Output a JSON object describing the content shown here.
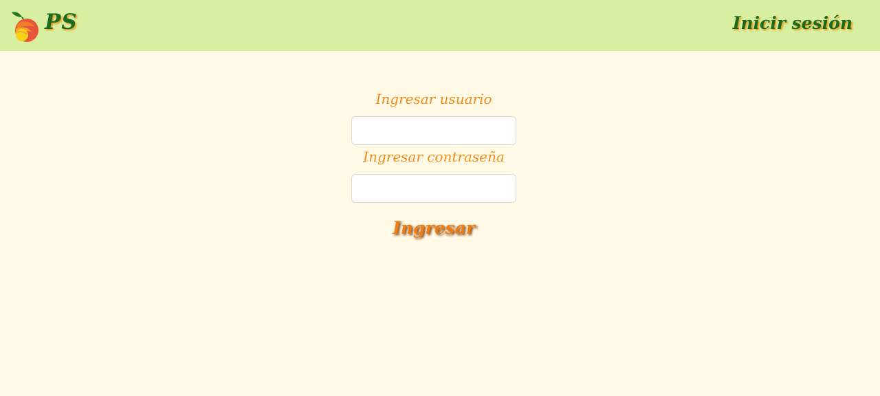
{
  "header": {
    "brand": "PS",
    "title": "Inicir sesión",
    "logo_icon": "peach-logo-icon"
  },
  "login_form": {
    "username_label": "Ingresar usuario",
    "username_value": "",
    "password_label": "Ingresar contraseña",
    "password_value": "",
    "submit_label": "Ingresar"
  },
  "colors": {
    "header_bg": "#d8efa2",
    "page_bg": "#fff9e6",
    "brand_green": "#1d6a1f",
    "accent_orange": "#ef8d1a",
    "shadow_gold": "#e1a021"
  }
}
